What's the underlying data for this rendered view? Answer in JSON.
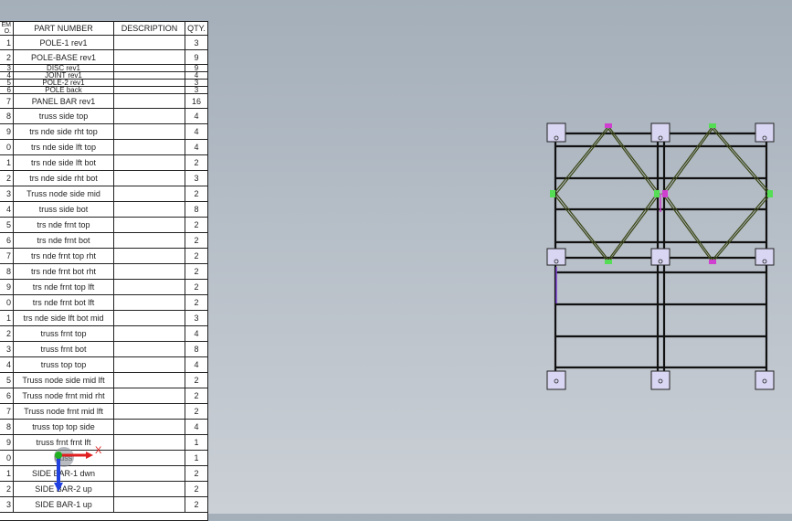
{
  "bom": {
    "headers": {
      "item": "ITEM NO.",
      "item_top": "EM",
      "item_bottom": "O.",
      "part": "PART NUMBER",
      "description": "DESCRIPTION",
      "qty": "QTY."
    },
    "rows": [
      {
        "item": "1",
        "part": "POLE-1 rev1",
        "desc": "",
        "qty": "3"
      },
      {
        "item": "2",
        "part": "POLE-BASE rev1",
        "desc": "",
        "qty": "9"
      },
      {
        "item": "3",
        "part": "DISC rev1",
        "desc": "",
        "qty": "9"
      },
      {
        "item": "4",
        "part": "JOINT rev1",
        "desc": "",
        "qty": "4"
      },
      {
        "item": "5",
        "part": "POLE-2 rev1",
        "desc": "",
        "qty": "3"
      },
      {
        "item": "6",
        "part": "POLE back",
        "desc": "",
        "qty": "3"
      },
      {
        "item": "7",
        "part": "PANEL BAR rev1",
        "desc": "",
        "qty": "16"
      },
      {
        "item": "8",
        "part": "truss side top",
        "desc": "",
        "qty": "4"
      },
      {
        "item": "9",
        "part": "trs nde side rht top",
        "desc": "",
        "qty": "4"
      },
      {
        "item": "0",
        "part": "trs nde side lft top",
        "desc": "",
        "qty": "4"
      },
      {
        "item": "1",
        "part": "trs nde side lft bot",
        "desc": "",
        "qty": "2"
      },
      {
        "item": "2",
        "part": "trs nde side rht bot",
        "desc": "",
        "qty": "3"
      },
      {
        "item": "3",
        "part": "Truss node side mid",
        "desc": "",
        "qty": "2"
      },
      {
        "item": "4",
        "part": "truss side bot",
        "desc": "",
        "qty": "8"
      },
      {
        "item": "5",
        "part": "trs nde frnt top",
        "desc": "",
        "qty": "2"
      },
      {
        "item": "6",
        "part": "trs nde frnt bot",
        "desc": "",
        "qty": "2"
      },
      {
        "item": "7",
        "part": "trs nde frnt top rht",
        "desc": "",
        "qty": "2"
      },
      {
        "item": "8",
        "part": "trs nde frnt bot rht",
        "desc": "",
        "qty": "2"
      },
      {
        "item": "9",
        "part": "trs nde frnt top lft",
        "desc": "",
        "qty": "2"
      },
      {
        "item": "0",
        "part": "trs nde frnt bot lft",
        "desc": "",
        "qty": "2"
      },
      {
        "item": "1",
        "part": "trs nde side lft bot mid",
        "desc": "",
        "qty": "3"
      },
      {
        "item": "2",
        "part": "truss frnt top",
        "desc": "",
        "qty": "4"
      },
      {
        "item": "3",
        "part": "truss frnt bot",
        "desc": "",
        "qty": "8"
      },
      {
        "item": "4",
        "part": "truss top top",
        "desc": "",
        "qty": "4"
      },
      {
        "item": "5",
        "part": "Truss node side mid lft",
        "desc": "",
        "qty": "2"
      },
      {
        "item": "6",
        "part": "Truss node frnt mid rht",
        "desc": "",
        "qty": "2"
      },
      {
        "item": "7",
        "part": "Truss node frnt mid lft",
        "desc": "",
        "qty": "2"
      },
      {
        "item": "8",
        "part": "truss top top side",
        "desc": "",
        "qty": "4"
      },
      {
        "item": "9",
        "part": "truss frnt frnt lft",
        "desc": "",
        "qty": "1"
      },
      {
        "item": "0",
        "part": "truss",
        "desc": "",
        "qty": "1"
      },
      {
        "item": "1",
        "part": "SIDE BAR-1 dwn",
        "desc": "",
        "qty": "2"
      },
      {
        "item": "2",
        "part": "SIDE BAR-2 up",
        "desc": "",
        "qty": "2"
      },
      {
        "item": "3",
        "part": "SIDE BAR-1 up",
        "desc": "",
        "qty": "2"
      }
    ]
  },
  "triad": {
    "x_label": "X"
  },
  "colors": {
    "background": "#b4bdc6",
    "member": "#111111",
    "brace": "#3f4a1c",
    "plate": "#d8d6f2",
    "node_green": "#55dd55",
    "node_magenta": "#d040d0",
    "axis_x": "#e02020",
    "axis_y": "#20b020",
    "axis_z": "#2040e0"
  }
}
